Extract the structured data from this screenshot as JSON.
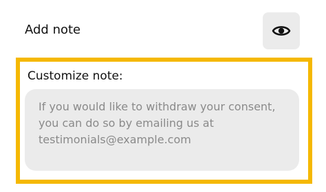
{
  "add_note": {
    "label": "Add note",
    "preview_icon": "eye-icon"
  },
  "customize": {
    "label": "Customize note:",
    "note_value": "",
    "note_placeholder": "If you would like to withdraw your consent, you can do so by emailing us at testimonials@example.com"
  },
  "colors": {
    "highlight_border": "#f5b800",
    "field_background": "#ebebeb",
    "placeholder_text": "#8a8a8a"
  }
}
